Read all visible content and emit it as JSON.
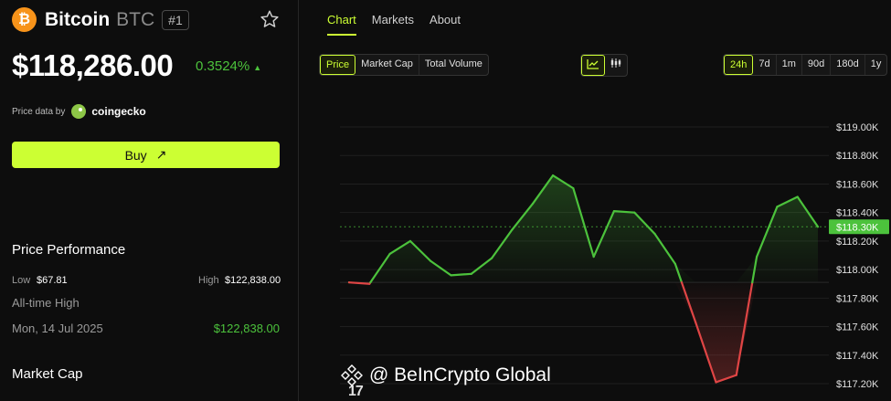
{
  "coin": {
    "logo_glyph": "₿",
    "name": "Bitcoin",
    "symbol": "BTC",
    "rank": "#1",
    "price": "$118,286.00",
    "change": "0.3524%",
    "change_arrow": "▲",
    "source_label": "Price data by",
    "source_brand": "coingecko",
    "buy_label": "Buy",
    "buy_arrow": "↗"
  },
  "performance": {
    "title": "Price Performance",
    "low_label": "Low",
    "low_value": "$67.81",
    "high_label": "High",
    "high_value": "$122,838.00",
    "ath_label": "All-time High",
    "ath_date": "Mon, 14 Jul 2025",
    "ath_value": "$122,838.00"
  },
  "market_cap": {
    "title": "Market Cap"
  },
  "nav": {
    "tabs": [
      "Chart",
      "Markets",
      "About"
    ]
  },
  "metric_tabs": [
    "Price",
    "Market Cap",
    "Total Volume"
  ],
  "range_tabs": [
    "24h",
    "7d",
    "1m",
    "90d",
    "180d",
    "1y"
  ],
  "watermark": "@ BeInCrypto Global",
  "tv_logo": "17",
  "colors": {
    "accent": "#ccff33",
    "up": "#4cc23c",
    "down": "#e04545"
  },
  "chart_data": {
    "type": "line",
    "ylabels": [
      "$119.00K",
      "$118.80K",
      "$118.60K",
      "$118.40K",
      "$118.20K",
      "$118.00K",
      "$117.80K",
      "$117.60K",
      "$117.40K",
      "$117.20K"
    ],
    "ylim": [
      117200,
      119000
    ],
    "baseline": 117910,
    "current_label": "$118.30K",
    "current_value": 118300,
    "values": [
      117910,
      117900,
      118110,
      118200,
      118060,
      117960,
      117970,
      118080,
      118280,
      118460,
      118660,
      118570,
      118090,
      118410,
      118400,
      118250,
      118040,
      117630,
      117210,
      117260,
      118090,
      118440,
      118510,
      118300
    ]
  }
}
